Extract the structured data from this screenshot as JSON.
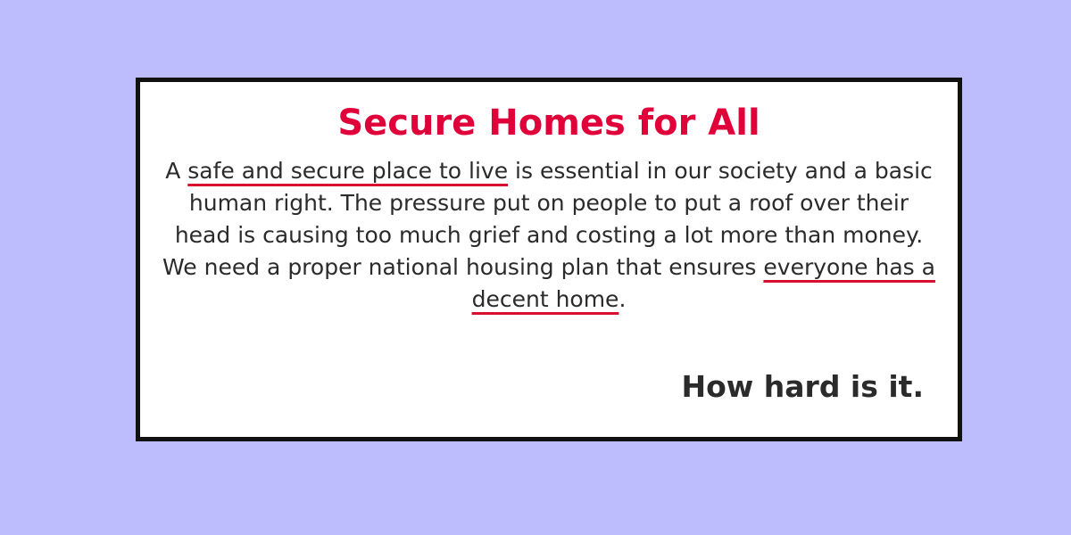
{
  "colors": {
    "background": "#bdbdfd",
    "card": "#ffffff",
    "card_border": "#111111",
    "title": "#e0003a",
    "text": "#2b2b2b",
    "underline": "#d80f2f"
  },
  "title": "Secure Homes for All",
  "body": {
    "part1": "A ",
    "highlight1": "safe and secure place to live",
    "part2": " is essential in our society and a basic human right. The pressure put on people to put a roof over their head is causing too much grief and costing a lot more than money. We need a proper national housing plan that ensures ",
    "highlight2": "everyone has a decent home",
    "part3": "."
  },
  "tagline": "How hard is it."
}
